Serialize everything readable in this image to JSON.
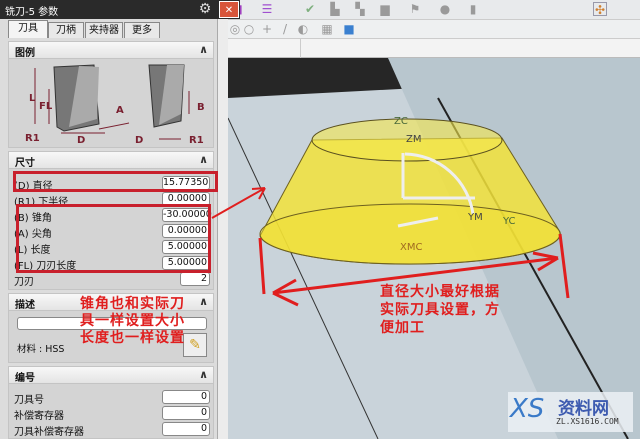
{
  "dialog": {
    "title": "铣刀-5 参数",
    "icons": {
      "settings": "gear-icon",
      "close": "close-icon"
    }
  },
  "tabs": [
    {
      "label": "刀具",
      "active": true
    },
    {
      "label": "刀柄"
    },
    {
      "label": "夹持器"
    },
    {
      "label": "更多"
    }
  ],
  "legend": {
    "header": "图例",
    "labels": {
      "L": "L",
      "FL": "FL",
      "R1": "R1",
      "D": "D",
      "A": "A",
      "B": "B"
    }
  },
  "dimensions": {
    "header": "尺寸",
    "rows": [
      {
        "label": "(D) 直径",
        "value": "15.77350"
      },
      {
        "label": "(R1) 下半径",
        "value": "0.00000"
      },
      {
        "label": "(B) 锥角",
        "value": "-30.00000"
      },
      {
        "label": "(A) 尖角",
        "value": "0.00000"
      },
      {
        "label": "(L) 长度",
        "value": "5.00000"
      },
      {
        "label": "(FL) 刀刃长度",
        "value": "5.00000"
      },
      {
        "label": "刀刃",
        "value": "2"
      }
    ]
  },
  "description": {
    "header": "描述",
    "input_value": "",
    "material": "材料 : HSS"
  },
  "numbering": {
    "header": "编号",
    "rows": [
      {
        "label": "刀具号",
        "value": "0"
      },
      {
        "label": "补偿寄存器",
        "value": "0"
      },
      {
        "label": "刀具补偿寄存器",
        "value": "0"
      }
    ]
  },
  "annotations": {
    "left": [
      "锥角也和实际刀",
      "具一样设置大小",
      "长度也一样设置"
    ],
    "right": [
      "直径大小最好根据",
      "实际刀具设置，方",
      "便加工"
    ],
    "color": "#e01e1e"
  },
  "viewport": {
    "axes": {
      "zc": "ZC",
      "zm": "ZM",
      "ym": "YM",
      "yc": "YC",
      "xmc": "XMC"
    },
    "cone_color": "#f2e23a"
  },
  "watermark": {
    "text": "资料网",
    "url_text": "ZL.XS1616.COM"
  }
}
